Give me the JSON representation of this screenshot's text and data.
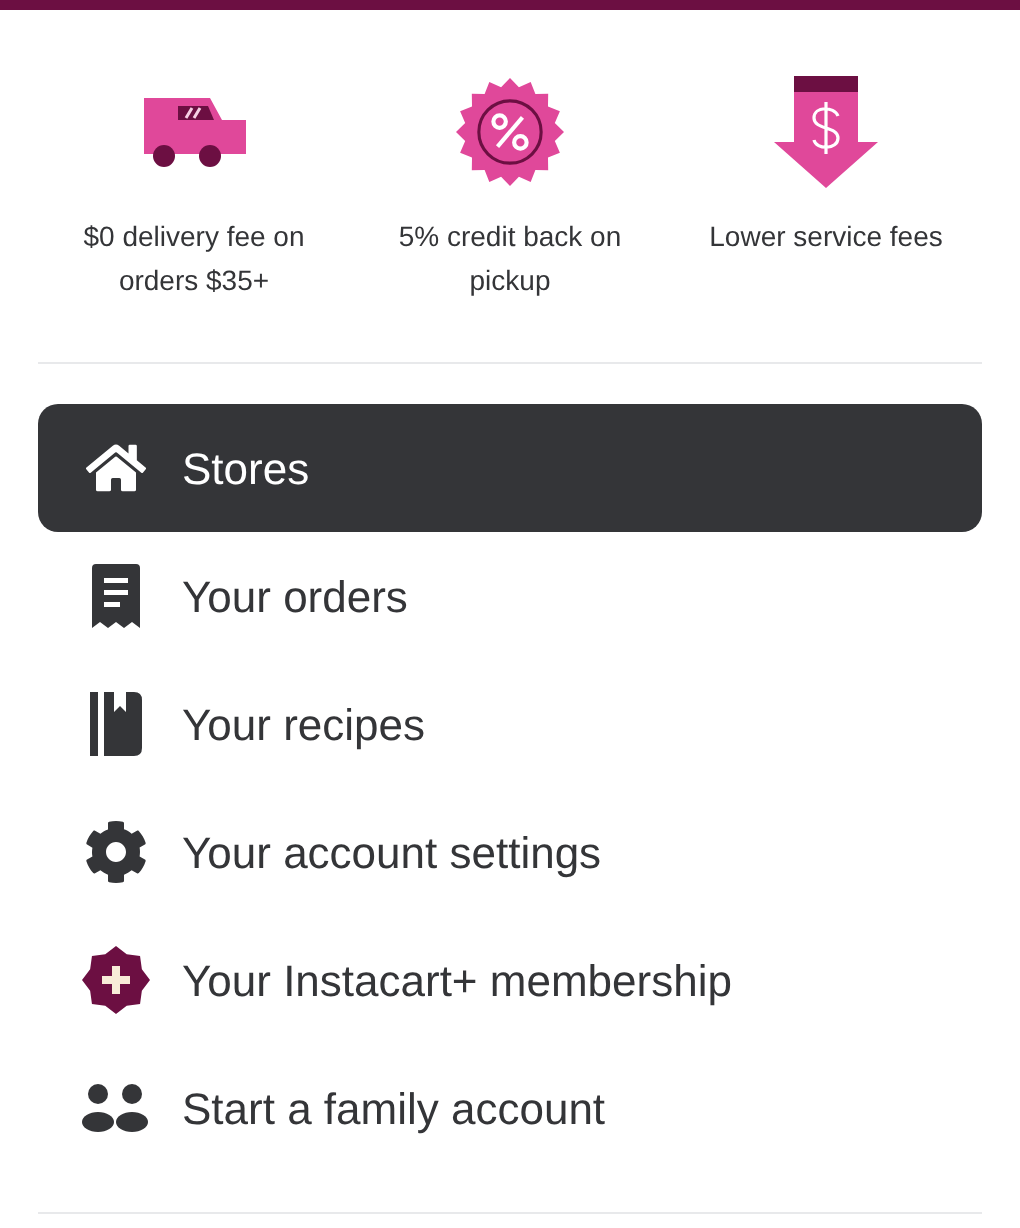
{
  "benefits": [
    {
      "kind": "truck",
      "text": "$0 delivery fee on orders $35+"
    },
    {
      "kind": "percent",
      "text": "5% credit back on pickup"
    },
    {
      "kind": "price-drop",
      "text": "Lower service fees"
    }
  ],
  "menu": [
    {
      "kind": "home",
      "label": "Stores",
      "selected": true
    },
    {
      "kind": "receipt",
      "label": "Your orders",
      "selected": false
    },
    {
      "kind": "book",
      "label": "Your recipes",
      "selected": false
    },
    {
      "kind": "gear",
      "label": "Your account settings",
      "selected": false
    },
    {
      "kind": "plus",
      "label": "Your Instacart+ membership",
      "selected": false
    },
    {
      "kind": "people",
      "label": "Start a family account",
      "selected": false
    }
  ]
}
